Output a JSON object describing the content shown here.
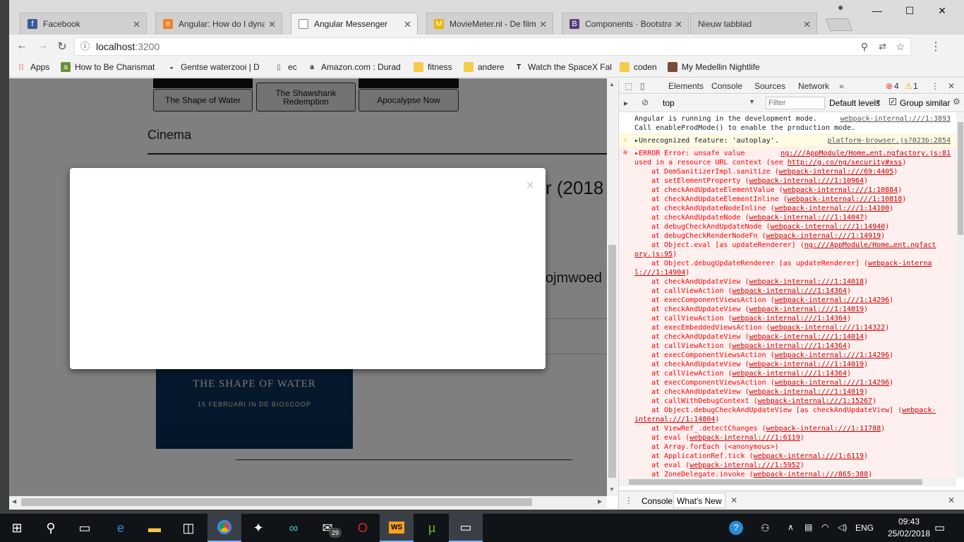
{
  "browser": {
    "tabs": [
      {
        "title": "Facebook",
        "favicon": "f",
        "color": "#3b5998"
      },
      {
        "title": "Angular: How do I dynan",
        "favicon": "stack",
        "color": "#f48024"
      },
      {
        "title": "Angular Messenger",
        "favicon": "page",
        "color": "#888888"
      },
      {
        "title": "MovieMeter.nl - De films",
        "favicon": "M",
        "color": "#e8b400"
      },
      {
        "title": "Components · Bootstrap",
        "favicon": "B",
        "color": "#563d7c"
      },
      {
        "title": "Nieuw tabblad",
        "favicon": "",
        "color": ""
      }
    ],
    "url_host": "localhost",
    "url_port": ":3200",
    "bookmarks": [
      {
        "label": "Apps"
      },
      {
        "label": "How to Be Charismat"
      },
      {
        "label": "Gentse waterzooi | D"
      },
      {
        "label": "ec"
      },
      {
        "label": "Amazon.com : Durad"
      },
      {
        "label": "fitness"
      },
      {
        "label": "andere"
      },
      {
        "label": "Watch the SpaceX Fal"
      },
      {
        "label": "coden"
      },
      {
        "label": "My Medellin Nightlife"
      }
    ]
  },
  "page": {
    "movie_buttons": [
      "The Shape of Water",
      "The Shawshank Redemption",
      "Apocalypse Now"
    ],
    "section_title": "Cinema",
    "partial_text_1": "r (2018",
    "partial_text_2": "ojmwoed",
    "poster_title": "THE SHAPE OF WATER",
    "poster_sub": "15 FEBRUARI IN DE BIOSCOOP",
    "modal_close": "×"
  },
  "devtools": {
    "tabs": [
      "Elements",
      "Console",
      "Sources",
      "Network"
    ],
    "error_count": "4",
    "warn_count": "1",
    "context": "top",
    "filter_placeholder": "Filter",
    "levels": "Default levels",
    "group_similar": "Group similar",
    "log_line_1": "Angular is running in the development mode.",
    "log_link_1": "webpack-internal:///1:3893",
    "log_line_2": "Call enableProdMode() to enable the production mode.",
    "warn_text": "Unrecognized feature: 'autoplay'.",
    "warn_link": "platform-browser.js?023b:2854",
    "err_head": "ERROR Error: unsafe value",
    "err_head_link": "ng:///AppModule/Home…ent.ngfactory.js:81",
    "err_line_2a": "used in a resource URL context (see ",
    "err_line_2_link": "http://g.co/ng/security#xss",
    "err_line_2b": ")",
    "stack": [
      {
        "fn": "at DomSanitizerImpl.sanitize (",
        "link": "webpack-internal:///69:4405",
        "end": ")"
      },
      {
        "fn": "at setElementProperty (",
        "link": "webpack-internal:///1:10964",
        "end": ")"
      },
      {
        "fn": "at checkAndUpdateElementValue (",
        "link": "webpack-internal:///1:10884",
        "end": ")"
      },
      {
        "fn": "at checkAndUpdateElementInline (",
        "link": "webpack-internal:///1:10818",
        "end": ")"
      },
      {
        "fn": "at checkAndUpdateNodeInline (",
        "link": "webpack-internal:///1:14100",
        "end": ")"
      },
      {
        "fn": "at checkAndUpdateNode (",
        "link": "webpack-internal:///1:14047",
        "end": ")"
      },
      {
        "fn": "at debugCheckAndUpdateNode (",
        "link": "webpack-internal:///1:14940",
        "end": ")"
      },
      {
        "fn": "at debugCheckRenderNodeFn (",
        "link": "webpack-internal:///1:14919",
        "end": ")"
      },
      {
        "fn": "at Object.eval [as updateRenderer] (",
        "link": "ng:///AppModule/Home…ent.ngfact",
        "end": ""
      },
      {
        "fn": "",
        "link": "ory.js:95",
        "end": ")",
        "cont": true
      },
      {
        "fn": "at Object.debugUpdateRenderer [as updateRenderer] (",
        "link": "webpack-interna",
        "end": ""
      },
      {
        "fn": "",
        "link": "l:///1:14904",
        "end": ")",
        "cont": true
      },
      {
        "fn": "at checkAndUpdateView (",
        "link": "webpack-internal:///1:14018",
        "end": ")"
      },
      {
        "fn": "at callViewAction (",
        "link": "webpack-internal:///1:14364",
        "end": ")"
      },
      {
        "fn": "at execComponentViewsAction (",
        "link": "webpack-internal:///1:14296",
        "end": ")"
      },
      {
        "fn": "at checkAndUpdateView (",
        "link": "webpack-internal:///1:14019",
        "end": ")"
      },
      {
        "fn": "at callViewAction (",
        "link": "webpack-internal:///1:14364",
        "end": ")"
      },
      {
        "fn": "at execEmbeddedViewsAction (",
        "link": "webpack-internal:///1:14322",
        "end": ")"
      },
      {
        "fn": "at checkAndUpdateView (",
        "link": "webpack-internal:///1:14014",
        "end": ")"
      },
      {
        "fn": "at callViewAction (",
        "link": "webpack-internal:///1:14364",
        "end": ")"
      },
      {
        "fn": "at execComponentViewsAction (",
        "link": "webpack-internal:///1:14296",
        "end": ")"
      },
      {
        "fn": "at checkAndUpdateView (",
        "link": "webpack-internal:///1:14019",
        "end": ")"
      },
      {
        "fn": "at callViewAction (",
        "link": "webpack-internal:///1:14364",
        "end": ")"
      },
      {
        "fn": "at execComponentViewsAction (",
        "link": "webpack-internal:///1:14296",
        "end": ")"
      },
      {
        "fn": "at checkAndUpdateView (",
        "link": "webpack-internal:///1:14019",
        "end": ")"
      },
      {
        "fn": "at callWithDebugContext (",
        "link": "webpack-internal:///1:15267",
        "end": ")"
      },
      {
        "fn": "at Object.debugCheckAndUpdateView [as checkAndUpdateView] (",
        "link": "webpack-",
        "end": ""
      },
      {
        "fn": "",
        "link": "internal:///1:14804",
        "end": ")",
        "cont": true
      },
      {
        "fn": "at ViewRef_.detectChanges (",
        "link": "webpack-internal:///1:11788",
        "end": ")"
      },
      {
        "fn": "at eval (",
        "link": "webpack-internal:///1:6119",
        "end": ")"
      },
      {
        "fn": "at Array.forEach (<anonymous>)",
        "link": "",
        "end": ""
      },
      {
        "fn": "at ApplicationRef.tick (",
        "link": "webpack-internal:///1:6119",
        "end": ")"
      },
      {
        "fn": "at eval (",
        "link": "webpack-internal:///1:5952",
        "end": ")"
      },
      {
        "fn": "at ZoneDelegate.invoke (",
        "link": "webpack-internal:///865:388",
        "end": ")"
      }
    ],
    "drawer_tabs": [
      "Console",
      "What's New"
    ]
  },
  "taskbar": {
    "time": "09:43",
    "date": "25/02/2018",
    "lang": "ENG",
    "mail_badge": "29"
  }
}
